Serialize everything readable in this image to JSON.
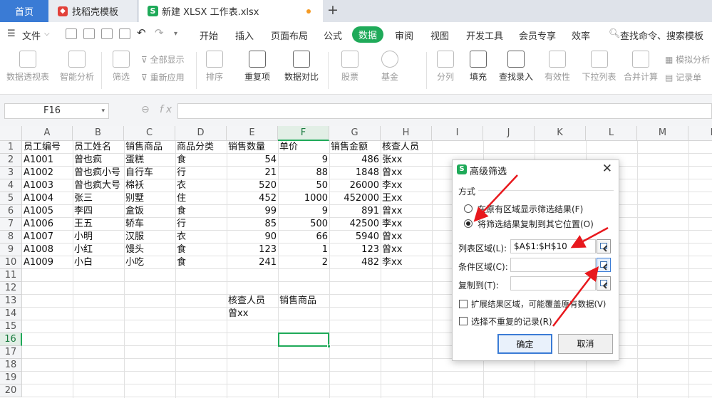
{
  "tabs": {
    "home": "首页",
    "template": "找稻壳模板",
    "file": "新建 XLSX 工作表.xlsx"
  },
  "menubar": {
    "file_menu": "文件",
    "items": [
      "开始",
      "插入",
      "页面布局",
      "公式",
      "数据",
      "审阅",
      "视图",
      "开发工具",
      "会员专享",
      "效率"
    ],
    "active": "数据",
    "search": "查找命令、搜索模板"
  },
  "ribbon": {
    "buttons": [
      "数据透视表",
      "智能分析",
      "筛选",
      "排序",
      "重复项",
      "数据对比",
      "股票",
      "基金",
      "分列",
      "填充",
      "查找录入",
      "有效性",
      "下拉列表",
      "合并计算",
      "记录单"
    ],
    "small": [
      "全部显示",
      "重新应用",
      "模拟分析"
    ]
  },
  "namebox": "F16",
  "fx": "fx",
  "columns": [
    "A",
    "B",
    "C",
    "D",
    "E",
    "F",
    "G",
    "H",
    "I",
    "J",
    "K",
    "L",
    "M",
    "N"
  ],
  "rows": [
    "1",
    "2",
    "3",
    "4",
    "5",
    "6",
    "7",
    "8",
    "9",
    "10",
    "11",
    "12",
    "13",
    "14",
    "15",
    "16",
    "17",
    "18",
    "19",
    "20"
  ],
  "table": {
    "headers": [
      "员工编号",
      "员工姓名",
      "销售商品",
      "商品分类",
      "销售数量",
      "单价",
      "销售金额",
      "核查人员"
    ],
    "rows": [
      [
        "A1001",
        "曾也疯",
        "蛋糕",
        "食",
        "54",
        "9",
        "486",
        "张xx"
      ],
      [
        "A1002",
        "曾也疯小号",
        "自行车",
        "行",
        "21",
        "88",
        "1848",
        "曾xx"
      ],
      [
        "A1003",
        "曾也疯大号",
        "棉袄",
        "衣",
        "520",
        "50",
        "26000",
        "李xx"
      ],
      [
        "A1004",
        "张三",
        "别墅",
        "住",
        "452",
        "1000",
        "452000",
        "王xx"
      ],
      [
        "A1005",
        "李四",
        "盒饭",
        "食",
        "99",
        "9",
        "891",
        "曾xx"
      ],
      [
        "A1006",
        "王五",
        "轿车",
        "行",
        "85",
        "500",
        "42500",
        "李xx"
      ],
      [
        "A1007",
        "小明",
        "汉服",
        "衣",
        "90",
        "66",
        "5940",
        "曾xx"
      ],
      [
        "A1008",
        "小红",
        "馒头",
        "食",
        "123",
        "1",
        "123",
        "曾xx"
      ],
      [
        "A1009",
        "小白",
        "小吃",
        "食",
        "241",
        "2",
        "482",
        "李xx"
      ]
    ]
  },
  "criteria": {
    "e13": "核查人员",
    "f13": "销售商品",
    "e14": "曾xx"
  },
  "dialog": {
    "title": "高级筛选",
    "method_label": "方式",
    "option1": "在原有区域显示筛选结果(F)",
    "option2": "将筛选结果复制到其它位置(O)",
    "list_label": "列表区域(L):",
    "list_value": "$A$1:$H$10",
    "criteria_label": "条件区域(C):",
    "copy_label": "复制到(T):",
    "check1": "扩展结果区域，可能覆盖原有数据(V)",
    "check2": "选择不重复的记录(R)",
    "ok": "确定",
    "cancel": "取消"
  },
  "colors": {
    "accent": "#1faa59",
    "annotation": "#e8181d",
    "home_tab": "#3a7bd5"
  }
}
